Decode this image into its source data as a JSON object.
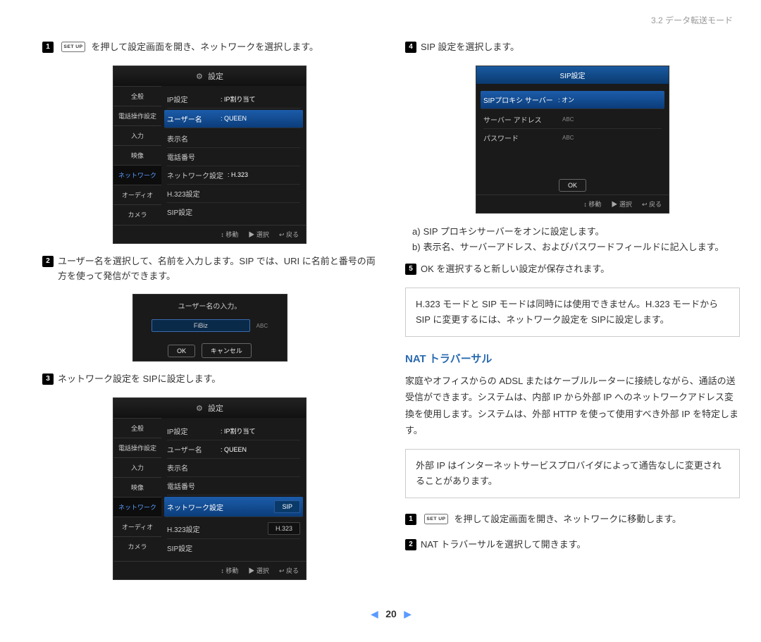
{
  "header": "3.2 データ転送モード",
  "setup_key": "SET UP",
  "left": {
    "s1": "を押して設定画面を開き、ネットワークを選択します。",
    "s2": "ユーザー名を選択して、名前を入力します。SIP では、URI に名前と番号の両方を使って発信ができます。",
    "s3": "ネットワーク設定を SIPに設定します。"
  },
  "right": {
    "s4": "SIP 設定を選択します。",
    "a": "SIP プロキシサーバーをオンに設定します。",
    "b": "表示名、サーバーアドレス、およびパスワードフィールドに記入します。",
    "s5": "OK を選択すると新しい設定が保存されます。",
    "note1": "H.323 モードと SIP モードは同時には使用できません。H.323 モードから SIP に変更するには、ネットワーク設定を SIPに設定します。",
    "nat_h": "NAT トラバーサル",
    "nat_p": "家庭やオフィスからの ADSL またはケーブルルーターに接続しながら、通話の送受信ができます。システムは、内部 IP から外部 IP へのネットワークアドレス変換を使用します。システムは、外部 HTTP を使って使用すべき外部 IP を特定します。",
    "nat_note": "外部 IP はインターネットサービスプロバイダによって通告なしに変更されることがあります。",
    "n1": "を押して設定画面を開き、ネットワークに移動します。",
    "n2": "NAT トラバーサルを選択して開きます。"
  },
  "sc_settings": {
    "title": "設定",
    "sidebar": [
      "全般",
      "電話操作設定",
      "入力",
      "映像",
      "ネットワーク",
      "オーディオ",
      "カメラ"
    ],
    "rows": {
      "ip": "IP設定",
      "ip_v": ": IP割り当て",
      "user": "ユーザー名",
      "user_v": ": QUEEN",
      "disp": "表示名",
      "tel": "電話番号",
      "net": "ネットワーク設定",
      "net_v": ": H.323",
      "h323": "H.323設定",
      "sip": "SIP設定",
      "drop_sip": "SIP",
      "drop_h323": "H.323"
    },
    "footer": {
      "move": "移動",
      "select": "選択",
      "back": "戻る"
    }
  },
  "sc_input": {
    "title": "ユーザー名の入力。",
    "val": "FiBiz",
    "ok": "OK",
    "cancel": "キャンセル",
    "abc": "ABC"
  },
  "sc_sip": {
    "title": "SIP設定",
    "proxy": "SIPプロキシ サーバー",
    "proxy_v": ": オン",
    "addr": "サーバー アドレス",
    "pw": "パスワード",
    "ok": "OK",
    "abc": "ABC"
  },
  "page": "20"
}
